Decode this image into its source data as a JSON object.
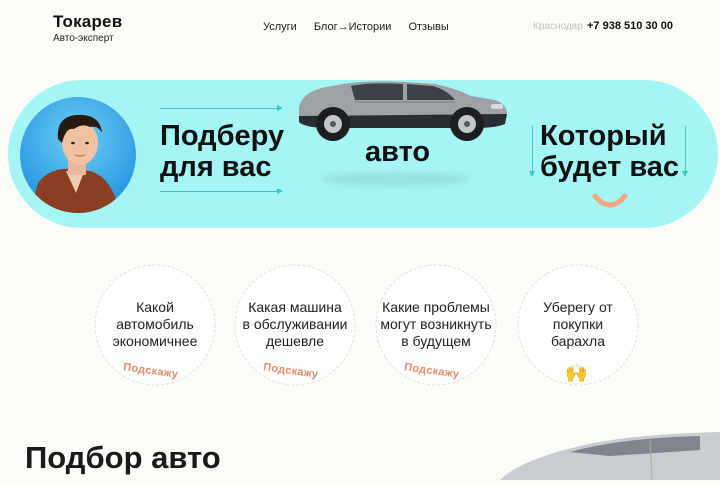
{
  "header": {
    "logo_title": "Токарев",
    "logo_subtitle": "Авто-эксперт",
    "nav": [
      "Услуги",
      "Блог→Истории",
      "Отзывы"
    ],
    "city": "Краснодар",
    "phone": "+7 938 510 30 00"
  },
  "hero": {
    "left_line1": "Подберу",
    "left_line2": "для вас",
    "center": "авто",
    "right_line1": "Который",
    "right_line2": "будет вас"
  },
  "badges": [
    {
      "lines": [
        "Какой",
        "автомобиль",
        "экономичнее"
      ],
      "tag": "Подскажу"
    },
    {
      "lines": [
        "Какая машина",
        "в обслуживании",
        "дешевле"
      ],
      "tag": "Подскажу"
    },
    {
      "lines": [
        "Какие проблемы",
        "могут возникнуть",
        "в будущем"
      ],
      "tag": "Подскажу"
    },
    {
      "lines": [
        "Уберегу от",
        "покупки",
        "барахла"
      ],
      "emoji": "🙌"
    }
  ],
  "section": {
    "title": "Подбор авто"
  },
  "colors": {
    "hero_bg": "#a5f5f4",
    "accent_line": "#3fc7c0",
    "tag": "#e88c6e",
    "smile": "#f0a882"
  }
}
